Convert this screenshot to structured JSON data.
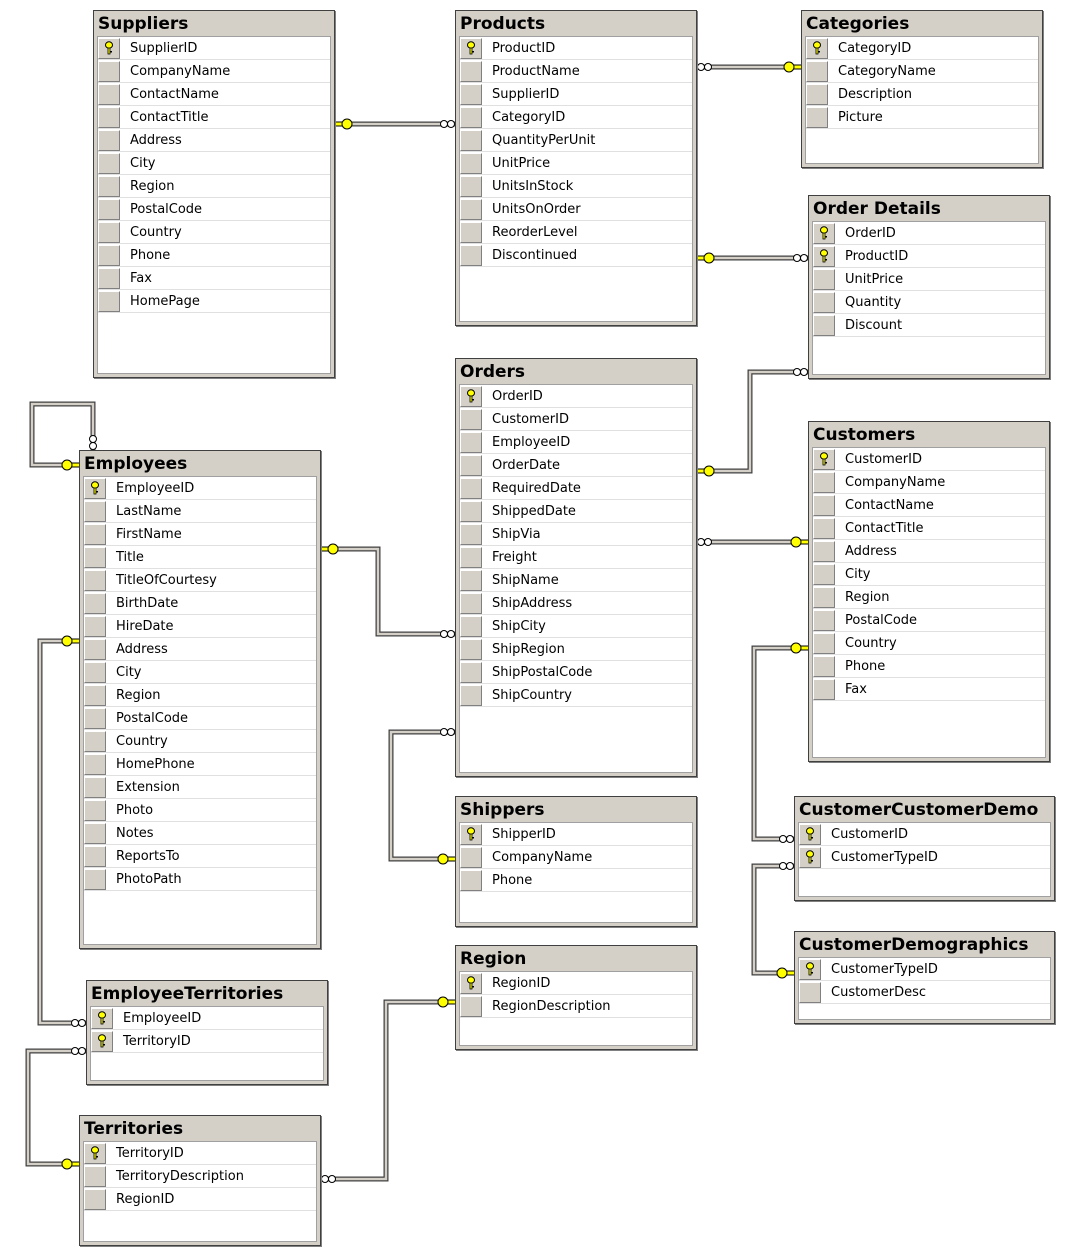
{
  "colors": {
    "table_bg": "#d4d0c8",
    "key": "#ffff00",
    "line": "#808080"
  },
  "tables": [
    {
      "name": "Suppliers",
      "columns": [
        {
          "name": "SupplierID",
          "pk": true
        },
        {
          "name": "CompanyName"
        },
        {
          "name": "ContactName"
        },
        {
          "name": "ContactTitle"
        },
        {
          "name": "Address"
        },
        {
          "name": "City"
        },
        {
          "name": "Region"
        },
        {
          "name": "PostalCode"
        },
        {
          "name": "Country"
        },
        {
          "name": "Phone"
        },
        {
          "name": "Fax"
        },
        {
          "name": "HomePage"
        }
      ]
    },
    {
      "name": "Products",
      "columns": [
        {
          "name": "ProductID",
          "pk": true
        },
        {
          "name": "ProductName"
        },
        {
          "name": "SupplierID"
        },
        {
          "name": "CategoryID"
        },
        {
          "name": "QuantityPerUnit"
        },
        {
          "name": "UnitPrice"
        },
        {
          "name": "UnitsInStock"
        },
        {
          "name": "UnitsOnOrder"
        },
        {
          "name": "ReorderLevel"
        },
        {
          "name": "Discontinued"
        }
      ]
    },
    {
      "name": "Categories",
      "columns": [
        {
          "name": "CategoryID",
          "pk": true
        },
        {
          "name": "CategoryName"
        },
        {
          "name": "Description"
        },
        {
          "name": "Picture"
        }
      ]
    },
    {
      "name": "Order Details",
      "columns": [
        {
          "name": "OrderID",
          "pk": true
        },
        {
          "name": "ProductID",
          "pk": true
        },
        {
          "name": "UnitPrice"
        },
        {
          "name": "Quantity"
        },
        {
          "name": "Discount"
        }
      ]
    },
    {
      "name": "Orders",
      "columns": [
        {
          "name": "OrderID",
          "pk": true
        },
        {
          "name": "CustomerID"
        },
        {
          "name": "EmployeeID"
        },
        {
          "name": "OrderDate"
        },
        {
          "name": "RequiredDate"
        },
        {
          "name": "ShippedDate"
        },
        {
          "name": "ShipVia"
        },
        {
          "name": "Freight"
        },
        {
          "name": "ShipName"
        },
        {
          "name": "ShipAddress"
        },
        {
          "name": "ShipCity"
        },
        {
          "name": "ShipRegion"
        },
        {
          "name": "ShipPostalCode"
        },
        {
          "name": "ShipCountry"
        }
      ]
    },
    {
      "name": "Customers",
      "columns": [
        {
          "name": "CustomerID",
          "pk": true
        },
        {
          "name": "CompanyName"
        },
        {
          "name": "ContactName"
        },
        {
          "name": "ContactTitle"
        },
        {
          "name": "Address"
        },
        {
          "name": "City"
        },
        {
          "name": "Region"
        },
        {
          "name": "PostalCode"
        },
        {
          "name": "Country"
        },
        {
          "name": "Phone"
        },
        {
          "name": "Fax"
        }
      ]
    },
    {
      "name": "Employees",
      "columns": [
        {
          "name": "EmployeeID",
          "pk": true
        },
        {
          "name": "LastName"
        },
        {
          "name": "FirstName"
        },
        {
          "name": "Title"
        },
        {
          "name": "TitleOfCourtesy"
        },
        {
          "name": "BirthDate"
        },
        {
          "name": "HireDate"
        },
        {
          "name": "Address"
        },
        {
          "name": "City"
        },
        {
          "name": "Region"
        },
        {
          "name": "PostalCode"
        },
        {
          "name": "Country"
        },
        {
          "name": "HomePhone"
        },
        {
          "name": "Extension"
        },
        {
          "name": "Photo"
        },
        {
          "name": "Notes"
        },
        {
          "name": "ReportsTo"
        },
        {
          "name": "PhotoPath"
        }
      ]
    },
    {
      "name": "Shippers",
      "columns": [
        {
          "name": "ShipperID",
          "pk": true
        },
        {
          "name": "CompanyName"
        },
        {
          "name": "Phone"
        }
      ]
    },
    {
      "name": "Region",
      "columns": [
        {
          "name": "RegionID",
          "pk": true
        },
        {
          "name": "RegionDescription"
        }
      ]
    },
    {
      "name": "CustomerCustomerDemo",
      "columns": [
        {
          "name": "CustomerID",
          "pk": true
        },
        {
          "name": "CustomerTypeID",
          "pk": true
        }
      ]
    },
    {
      "name": "CustomerDemographics",
      "columns": [
        {
          "name": "CustomerTypeID",
          "pk": true
        },
        {
          "name": "CustomerDesc"
        }
      ]
    },
    {
      "name": "EmployeeTerritories",
      "columns": [
        {
          "name": "EmployeeID",
          "pk": true
        },
        {
          "name": "TerritoryID",
          "pk": true
        }
      ]
    },
    {
      "name": "Territories",
      "columns": [
        {
          "name": "TerritoryID",
          "pk": true
        },
        {
          "name": "TerritoryDescription"
        },
        {
          "name": "RegionID"
        }
      ]
    }
  ],
  "relationships": [
    {
      "one": "Suppliers",
      "many": "Products"
    },
    {
      "one": "Categories",
      "many": "Products"
    },
    {
      "one": "Products",
      "many": "Order Details"
    },
    {
      "one": "Orders",
      "many": "Order Details"
    },
    {
      "one": "Customers",
      "many": "Orders"
    },
    {
      "one": "Employees",
      "many": "Employees"
    },
    {
      "one": "Employees",
      "many": "Orders"
    },
    {
      "one": "Employees",
      "many": "EmployeeTerritories"
    },
    {
      "one": "Shippers",
      "many": "Orders"
    },
    {
      "one": "Customers",
      "many": "CustomerCustomerDemo"
    },
    {
      "one": "CustomerDemographics",
      "many": "CustomerCustomerDemo"
    },
    {
      "one": "Territories",
      "many": "EmployeeTerritories"
    },
    {
      "one": "Region",
      "many": "Territories"
    }
  ]
}
